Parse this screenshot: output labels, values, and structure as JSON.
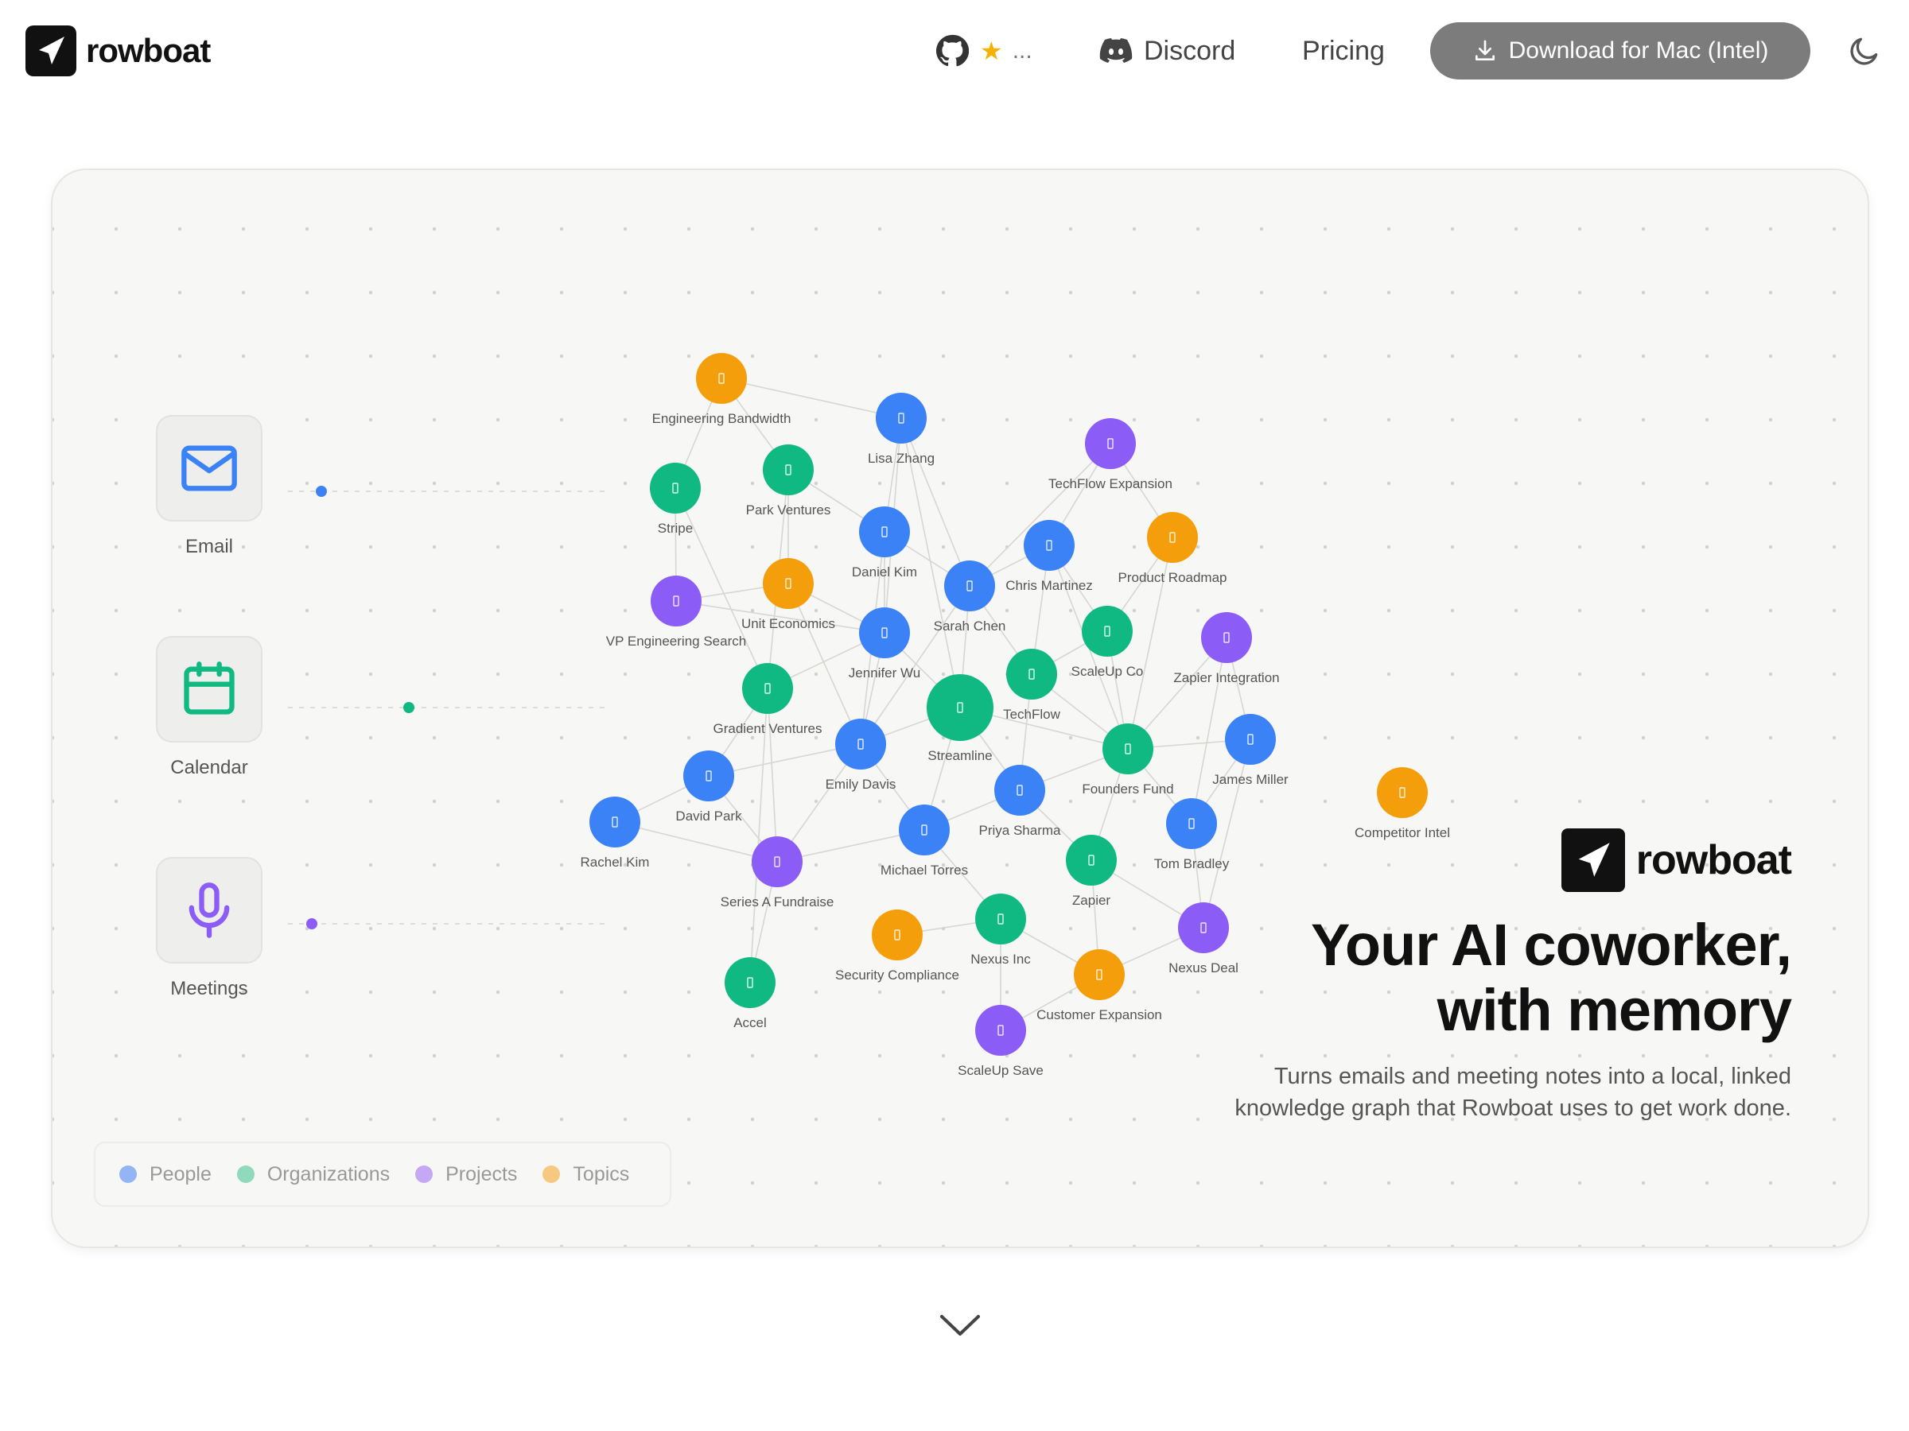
{
  "nav": {
    "brand": "rowboat",
    "github_stars": "...",
    "discord_label": "Discord",
    "pricing_label": "Pricing",
    "download_label": "Download for Mac (Intel)"
  },
  "sources": [
    {
      "label": "Email",
      "icon": "mail-icon",
      "color": "#3b82f6"
    },
    {
      "label": "Calendar",
      "icon": "calendar-icon",
      "color": "#10b981"
    },
    {
      "label": "Meetings",
      "icon": "microphone-icon",
      "color": "#8b5cf6"
    }
  ],
  "graph": {
    "colors": {
      "person": "#3b82f6",
      "org": "#10b981",
      "project": "#8b5cf6",
      "topic": "#f59e0b"
    },
    "nodes": [
      {
        "id": "engbw",
        "label": "Engineering Bandwidth",
        "type": "topic"
      },
      {
        "id": "lisa",
        "label": "Lisa Zhang",
        "type": "person"
      },
      {
        "id": "stripe",
        "label": "Stripe",
        "type": "org"
      },
      {
        "id": "park",
        "label": "Park Ventures",
        "type": "org"
      },
      {
        "id": "techexp",
        "label": "TechFlow Expansion",
        "type": "project"
      },
      {
        "id": "daniel",
        "label": "Daniel Kim",
        "type": "person"
      },
      {
        "id": "chris",
        "label": "Chris Martinez",
        "type": "person"
      },
      {
        "id": "roadmap",
        "label": "Product Roadmap",
        "type": "topic"
      },
      {
        "id": "vpeng",
        "label": "VP Engineering Search",
        "type": "project"
      },
      {
        "id": "unitecon",
        "label": "Unit Economics",
        "type": "topic"
      },
      {
        "id": "sarah",
        "label": "Sarah Chen",
        "type": "person"
      },
      {
        "id": "jennifer",
        "label": "Jennifer Wu",
        "type": "person"
      },
      {
        "id": "scaleupco",
        "label": "ScaleUp Co",
        "type": "org"
      },
      {
        "id": "zapint",
        "label": "Zapier Integration",
        "type": "project"
      },
      {
        "id": "techflow",
        "label": "TechFlow",
        "type": "org"
      },
      {
        "id": "gradient",
        "label": "Gradient Ventures",
        "type": "org"
      },
      {
        "id": "streamline",
        "label": "Streamline",
        "type": "org"
      },
      {
        "id": "emily",
        "label": "Emily Davis",
        "type": "person"
      },
      {
        "id": "founders",
        "label": "Founders Fund",
        "type": "org"
      },
      {
        "id": "james",
        "label": "James Miller",
        "type": "person"
      },
      {
        "id": "compintel",
        "label": "Competitor Intel",
        "type": "topic"
      },
      {
        "id": "david",
        "label": "David Park",
        "type": "person"
      },
      {
        "id": "priya",
        "label": "Priya Sharma",
        "type": "person"
      },
      {
        "id": "tom",
        "label": "Tom Bradley",
        "type": "person"
      },
      {
        "id": "rachel",
        "label": "Rachel Kim",
        "type": "person"
      },
      {
        "id": "seriesa",
        "label": "Series A Fundraise",
        "type": "project"
      },
      {
        "id": "michael",
        "label": "Michael Torres",
        "type": "person"
      },
      {
        "id": "zapier",
        "label": "Zapier",
        "type": "org"
      },
      {
        "id": "nexusinc",
        "label": "Nexus Inc",
        "type": "org"
      },
      {
        "id": "seccomp",
        "label": "Security Compliance",
        "type": "topic"
      },
      {
        "id": "nexusdeal",
        "label": "Nexus Deal",
        "type": "project"
      },
      {
        "id": "custexp",
        "label": "Customer Expansion",
        "type": "topic"
      },
      {
        "id": "accel",
        "label": "Accel",
        "type": "org"
      },
      {
        "id": "scaleupsave",
        "label": "ScaleUp Save",
        "type": "project"
      }
    ]
  },
  "legend": [
    {
      "label": "People",
      "color": "#93b4f5"
    },
    {
      "label": "Organizations",
      "color": "#8fd9bd"
    },
    {
      "label": "Projects",
      "color": "#c4a7f5"
    },
    {
      "label": "Topics",
      "color": "#f7c980"
    }
  ],
  "hero": {
    "brand": "rowboat",
    "headline_line1": "Your AI coworker,",
    "headline_line2": "with memory",
    "subtext_line1": "Turns emails and meeting notes into a local, linked",
    "subtext_line2": "knowledge graph that Rowboat uses to get work done."
  }
}
